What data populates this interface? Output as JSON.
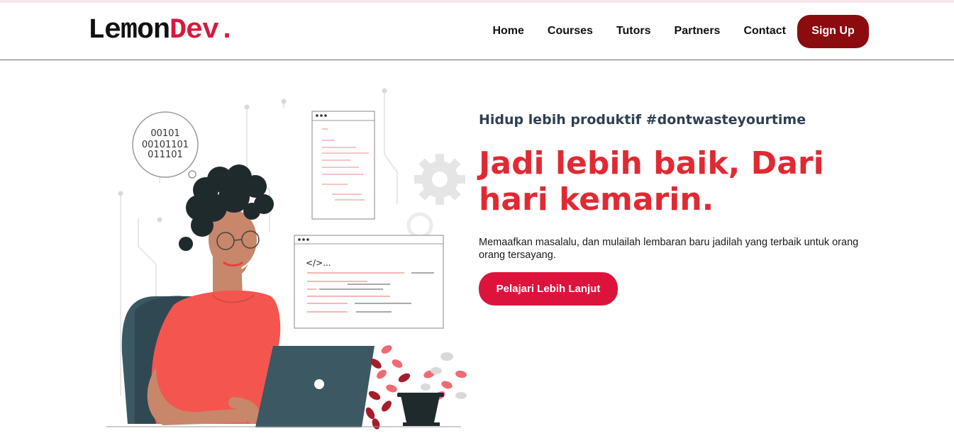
{
  "brand": {
    "name_part1": "Lemon",
    "name_part2": "Dev",
    "dot": ".",
    "accent": "#d7193f"
  },
  "nav": {
    "links": [
      "Home",
      "Courses",
      "Tutors",
      "Partners",
      "Contact"
    ],
    "signup_label": "Sign Up",
    "signup_color": "#8c0b0f"
  },
  "hero": {
    "tagline": "Hidup lebih produktif #dontwasteyourtime",
    "headline": "Jadi lebih baik, Dari hari kemarin.",
    "description": "Memaafkan masalalu, dan mulailah lembaran baru jadilah yang terbaik untuk orang orang tersayang.",
    "cta_label": "Pelajari Lebih Lanjut",
    "cta_color": "#dc143c",
    "headline_color": "#e02a33"
  },
  "illustration": {
    "binary_lines": [
      "00101",
      "00101101",
      "011101"
    ],
    "code_tag": "</>...",
    "icon": "developer-at-laptop"
  }
}
